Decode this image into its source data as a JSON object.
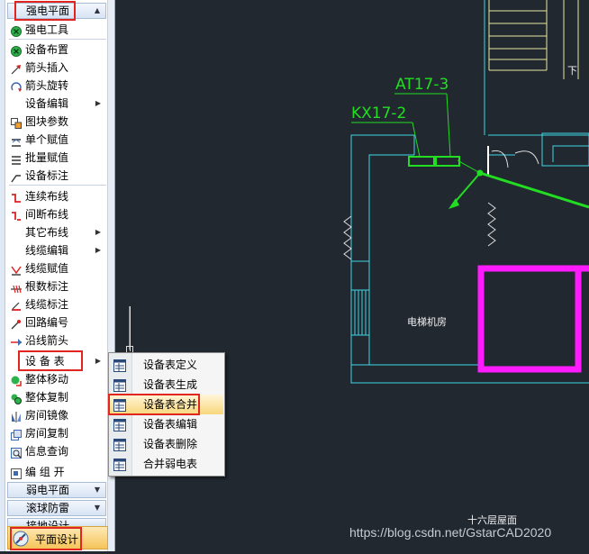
{
  "panel": {
    "header_top": "强电平面",
    "items": [
      {
        "label": "强电工具",
        "icon": "green-dot-icon"
      },
      {
        "label": "设备布置",
        "icon": "green-dot-icon"
      },
      {
        "label": "箭头插入",
        "icon": "arrow-insert-icon"
      },
      {
        "label": "箭头旋转",
        "icon": "arrow-rotate-icon"
      },
      {
        "label": "设备编辑",
        "icon": "",
        "submenu": true
      },
      {
        "label": "图块参数",
        "icon": "block-param-icon"
      },
      {
        "label": "单个赋值",
        "icon": "single-assign-icon"
      },
      {
        "label": "批量赋值",
        "icon": "batch-assign-icon"
      },
      {
        "label": "设备标注",
        "icon": "device-label-icon"
      },
      {
        "label": "连续布线",
        "icon": "continuous-wire-icon"
      },
      {
        "label": "间断布线",
        "icon": "broken-wire-icon"
      },
      {
        "label": "其它布线",
        "icon": "",
        "submenu": true
      },
      {
        "label": "线缆编辑",
        "icon": "",
        "submenu": true
      },
      {
        "label": "线缆赋值",
        "icon": "cable-assign-icon"
      },
      {
        "label": "根数标注",
        "icon": "count-label-icon"
      },
      {
        "label": "线缆标注",
        "icon": "cable-label-icon"
      },
      {
        "label": "回路编号",
        "icon": "loop-number-icon"
      },
      {
        "label": "沿线箭头",
        "icon": "along-arrow-icon"
      },
      {
        "label": "设 备 表",
        "icon": "",
        "submenu": true
      },
      {
        "label": "整体移动",
        "icon": "move-all-icon"
      },
      {
        "label": "整体复制",
        "icon": "copy-all-icon"
      },
      {
        "label": "房间镜像",
        "icon": "room-mirror-icon"
      },
      {
        "label": "房间复制",
        "icon": "room-copy-icon"
      },
      {
        "label": "信息查询",
        "icon": "info-query-icon"
      }
    ],
    "group_label": "编 组 开",
    "collapsed_headers": [
      "弱电平面",
      "滚球防雷",
      "接地设计"
    ],
    "bottom_button": "平面设计"
  },
  "flyout": {
    "items": [
      {
        "label": "设备表定义"
      },
      {
        "label": "设备表生成"
      },
      {
        "label": "设备表合并",
        "highlighted": true
      },
      {
        "label": "设备表编辑"
      },
      {
        "label": "设备表删除"
      },
      {
        "label": "合并弱电表"
      }
    ]
  },
  "cad": {
    "label_at": "AT17-3",
    "label_kx": "KX17-2",
    "room_name": "电梯机房",
    "floor_caption": "十六层屋面",
    "down_mark": "下"
  },
  "watermark": "https://blog.csdn.net/GstarCAD2020",
  "colors": {
    "canvas": "#212830",
    "cyan": "#3fd7e6",
    "green": "#22dd22",
    "magenta": "#ff1aff",
    "yellow": "#e8e8a0",
    "highlight_red": "#e0261f"
  }
}
